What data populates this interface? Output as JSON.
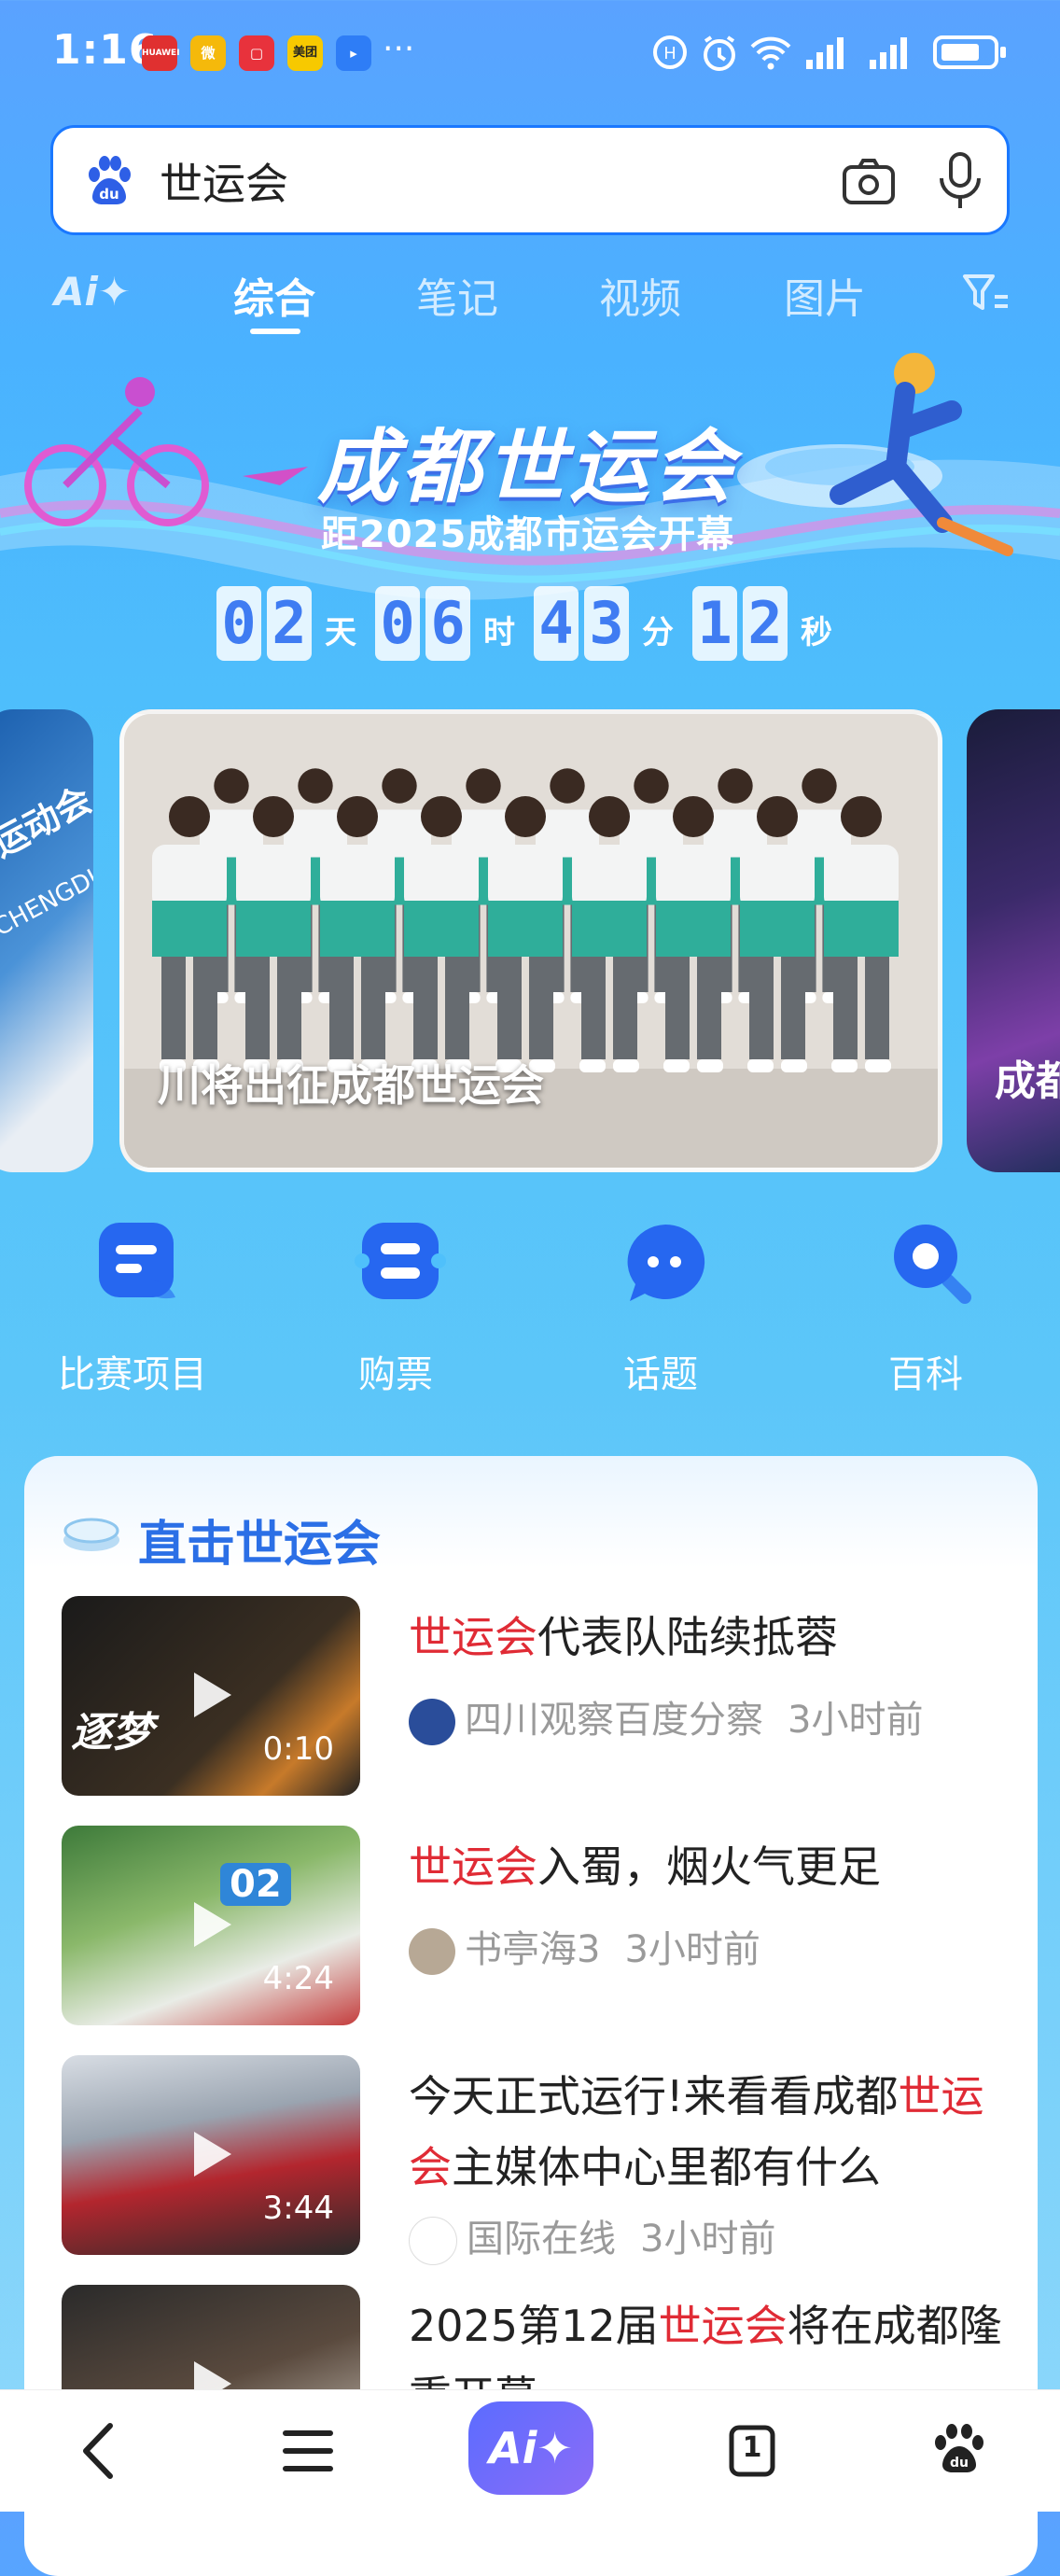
{
  "status_bar": {
    "time": "1:16",
    "more": "···",
    "app_icons": [
      {
        "name": "huawei-store-icon",
        "label": "HUAWEI",
        "color": "#e03030"
      },
      {
        "name": "weibo-icon",
        "label": "微",
        "color": "#f5b90b"
      },
      {
        "name": "red-app-icon",
        "label": "▢",
        "color": "#e8323c"
      },
      {
        "name": "meituan-icon",
        "label": "美团",
        "color": "#f7c900"
      },
      {
        "name": "blue-app-icon",
        "label": "▸",
        "color": "#2e7df6"
      }
    ]
  },
  "search": {
    "value": "世运会",
    "placeholder": ""
  },
  "tabs": {
    "ai": "Ai✦",
    "items": [
      "综合",
      "笔记",
      "视频",
      "图片"
    ],
    "active": 0
  },
  "banner": {
    "title": "成都世运会",
    "subtitle": "距2025成都市运会开幕",
    "countdown": [
      {
        "digits": "02",
        "unit": "天"
      },
      {
        "digits": "06",
        "unit": "时"
      },
      {
        "digits": "43",
        "unit": "分"
      },
      {
        "digits": "12",
        "unit": "秒"
      }
    ]
  },
  "carousel": {
    "left_fragment": "运动会",
    "left_fragment_en": "CHENGDU",
    "main_caption": "川将出征成都世运会",
    "right_fragment": "成都"
  },
  "shortcuts": [
    {
      "label": "比赛项目",
      "icon": "list-icon"
    },
    {
      "label": "购票",
      "icon": "ticket-icon"
    },
    {
      "label": "话题",
      "icon": "chat-bubble-icon"
    },
    {
      "label": "百科",
      "icon": "search-lens-icon"
    }
  ],
  "panel": {
    "title": "直击世运会",
    "news": [
      {
        "highlight": "世运会",
        "rest": "代表队陆续抵蓉",
        "tail": "",
        "source": "四川观察百度分察",
        "time": "3小时前",
        "duration": "0:10",
        "thumb_text": "逐梦"
      },
      {
        "highlight": "世运会",
        "rest": "入蜀，烟火气更足",
        "tail": "",
        "source": "书亭海3",
        "time": "3小时前",
        "duration": "4:24",
        "thumb_text": "02"
      },
      {
        "pre": "今天正式运行!来看看成都",
        "highlight": "世运会",
        "rest": "主媒体中心里都有什么",
        "source": "国际在线",
        "time": "3小时前",
        "duration": "3:44",
        "thumb_text": ""
      },
      {
        "pre": "2025第12届",
        "highlight": "世运会",
        "rest": "将在成都隆重开幕",
        "source": "",
        "time": "",
        "duration": "",
        "thumb_text": ""
      }
    ]
  },
  "bottom_nav": {
    "ai_label": "Ai✦",
    "tab_count": "1"
  }
}
